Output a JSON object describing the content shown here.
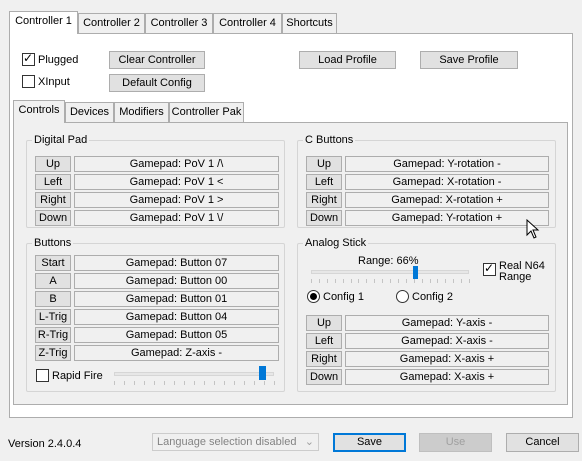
{
  "outer_tabs": [
    "Controller 1",
    "Controller 2",
    "Controller 3",
    "Controller 4",
    "Shortcuts"
  ],
  "top": {
    "plugged_label": "Plugged",
    "plugged_checked": true,
    "xinput_label": "XInput",
    "xinput_checked": false,
    "clear_controller": "Clear Controller",
    "default_config": "Default Config",
    "load_profile": "Load Profile",
    "save_profile": "Save Profile"
  },
  "inner_tabs": [
    "Controls",
    "Devices",
    "Modifiers",
    "Controller Pak"
  ],
  "digital_pad": {
    "title": "Digital Pad",
    "rows": [
      {
        "button": "Up",
        "value": "Gamepad: PoV 1 /\\"
      },
      {
        "button": "Left",
        "value": "Gamepad: PoV 1 <"
      },
      {
        "button": "Right",
        "value": "Gamepad: PoV 1 >"
      },
      {
        "button": "Down",
        "value": "Gamepad: PoV 1 \\/"
      }
    ]
  },
  "c_buttons": {
    "title": "C Buttons",
    "rows": [
      {
        "button": "Up",
        "value": "Gamepad: Y-rotation -"
      },
      {
        "button": "Left",
        "value": "Gamepad: X-rotation -"
      },
      {
        "button": "Right",
        "value": "Gamepad: X-rotation +"
      },
      {
        "button": "Down",
        "value": "Gamepad: Y-rotation +"
      }
    ]
  },
  "buttons": {
    "title": "Buttons",
    "rows": [
      {
        "button": "Start",
        "value": "Gamepad: Button 07"
      },
      {
        "button": "A",
        "value": "Gamepad: Button 00"
      },
      {
        "button": "B",
        "value": "Gamepad: Button 01"
      },
      {
        "button": "L-Trig",
        "value": "Gamepad: Button 04"
      },
      {
        "button": "R-Trig",
        "value": "Gamepad: Button 05"
      },
      {
        "button": "Z-Trig",
        "value": "Gamepad: Z-axis -"
      }
    ],
    "rapid_fire_label": "Rapid Fire",
    "rapid_fire_checked": false,
    "rapid_fire_level": 0.93
  },
  "analog_stick": {
    "title": "Analog Stick",
    "range_label": "Range: 66%",
    "range_level": 0.66,
    "real_n64_label_1": "Real N64",
    "real_n64_label_2": "Range",
    "real_n64_checked": true,
    "config1_label": "Config 1",
    "config2_label": "Config 2",
    "config_selected": 1,
    "rows": [
      {
        "button": "Up",
        "value": "Gamepad: Y-axis -"
      },
      {
        "button": "Left",
        "value": "Gamepad: X-axis -"
      },
      {
        "button": "Right",
        "value": "Gamepad: X-axis +"
      },
      {
        "button": "Down",
        "value": "Gamepad: X-axis +"
      }
    ]
  },
  "footer": {
    "version": "Version 2.4.0.4",
    "language_placeholder": "Language selection disabled",
    "save": "Save",
    "use": "Use",
    "cancel": "Cancel"
  },
  "colors": {
    "accent": "#0078d7",
    "window_bg": "#f0f0f0"
  }
}
